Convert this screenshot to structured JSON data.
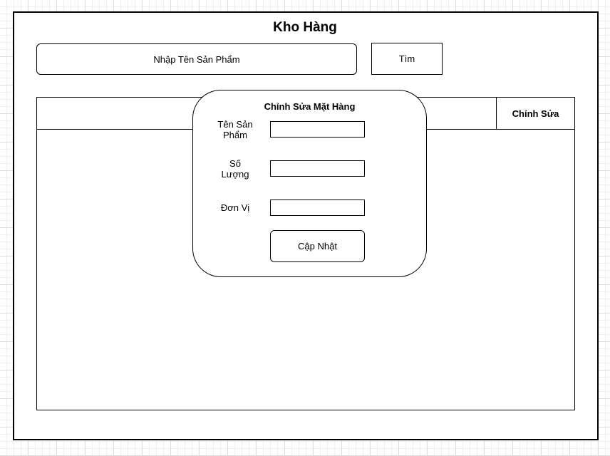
{
  "app": {
    "title": "Kho Hàng"
  },
  "search": {
    "placeholder": "Nhập Tên Sản Phẩm",
    "button_label": "Tìm"
  },
  "table": {
    "columns": [
      "",
      "Chỉnh Sửa"
    ],
    "rows": []
  },
  "edit_dialog": {
    "title": "Chỉnh Sửa Mặt Hàng",
    "fields": [
      {
        "label_line1": "Tên Sản",
        "label_line2": "Phẩm",
        "value": ""
      },
      {
        "label_line1": "Số",
        "label_line2": "Lượng",
        "value": ""
      },
      {
        "label_line1": "Đơn Vị",
        "label_line2": "",
        "value": ""
      }
    ],
    "submit_label": "Cập Nhật"
  }
}
